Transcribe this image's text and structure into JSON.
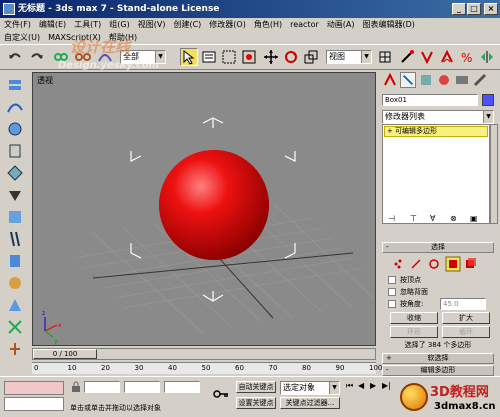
{
  "window": {
    "title": "无标题   - 3ds max 7   - Stand-alone License",
    "btn_min": "_",
    "btn_max": "□",
    "btn_close": "×"
  },
  "menu": [
    "文件(F)",
    "编辑(E)",
    "工具(T)",
    "组(G)",
    "视图(V)",
    "创建(C)",
    "修改器(O)",
    "角色(H)",
    "reactor",
    "动画(A)",
    "图表编辑器(D)"
  ],
  "menu2": [
    "自定义(U)",
    "MAXScript(X)",
    "帮助(H)"
  ],
  "toolbar": {
    "selection_filter": "全部",
    "ref_coord": "视图"
  },
  "viewport": {
    "label": "透视",
    "object_color": "#ee1111",
    "watermark_cn": "设计在线",
    "watermark_en": "Design.yesky.com"
  },
  "command_panel": {
    "object_name": "Box01",
    "color_swatch": "#5050ff",
    "modifier_list": "修改器列表",
    "stack_item": "可编辑多边形",
    "rollout_selection": "选择",
    "checkbox_vertex": "按顶点",
    "checkbox_ignore_back": "忽略背面",
    "checkbox_angle": "按角度:",
    "angle_value": "45.0",
    "btn_shrink": "收缩",
    "btn_grow": "扩大",
    "btn_ring": "环形",
    "btn_loop": "循环",
    "selection_status": "选择了 384 个多边形",
    "rollout_soft": "软选择",
    "rollout_edit": "编辑多边形"
  },
  "timeline": {
    "frame": "0 / 100",
    "ticks": [
      "0",
      "10",
      "20",
      "30",
      "40",
      "50",
      "60",
      "70",
      "80",
      "90",
      "100"
    ]
  },
  "status": {
    "prompt": "单击或单击并拖动以选择对象",
    "auto_key": "自动关键点",
    "set_key": "设置关键点",
    "key_filter": "选定对象",
    "key_filters_btn": "关键点过滤器..."
  },
  "brand": {
    "logo_text": "3D教程网",
    "logo_url": "3dmax8.cn"
  }
}
